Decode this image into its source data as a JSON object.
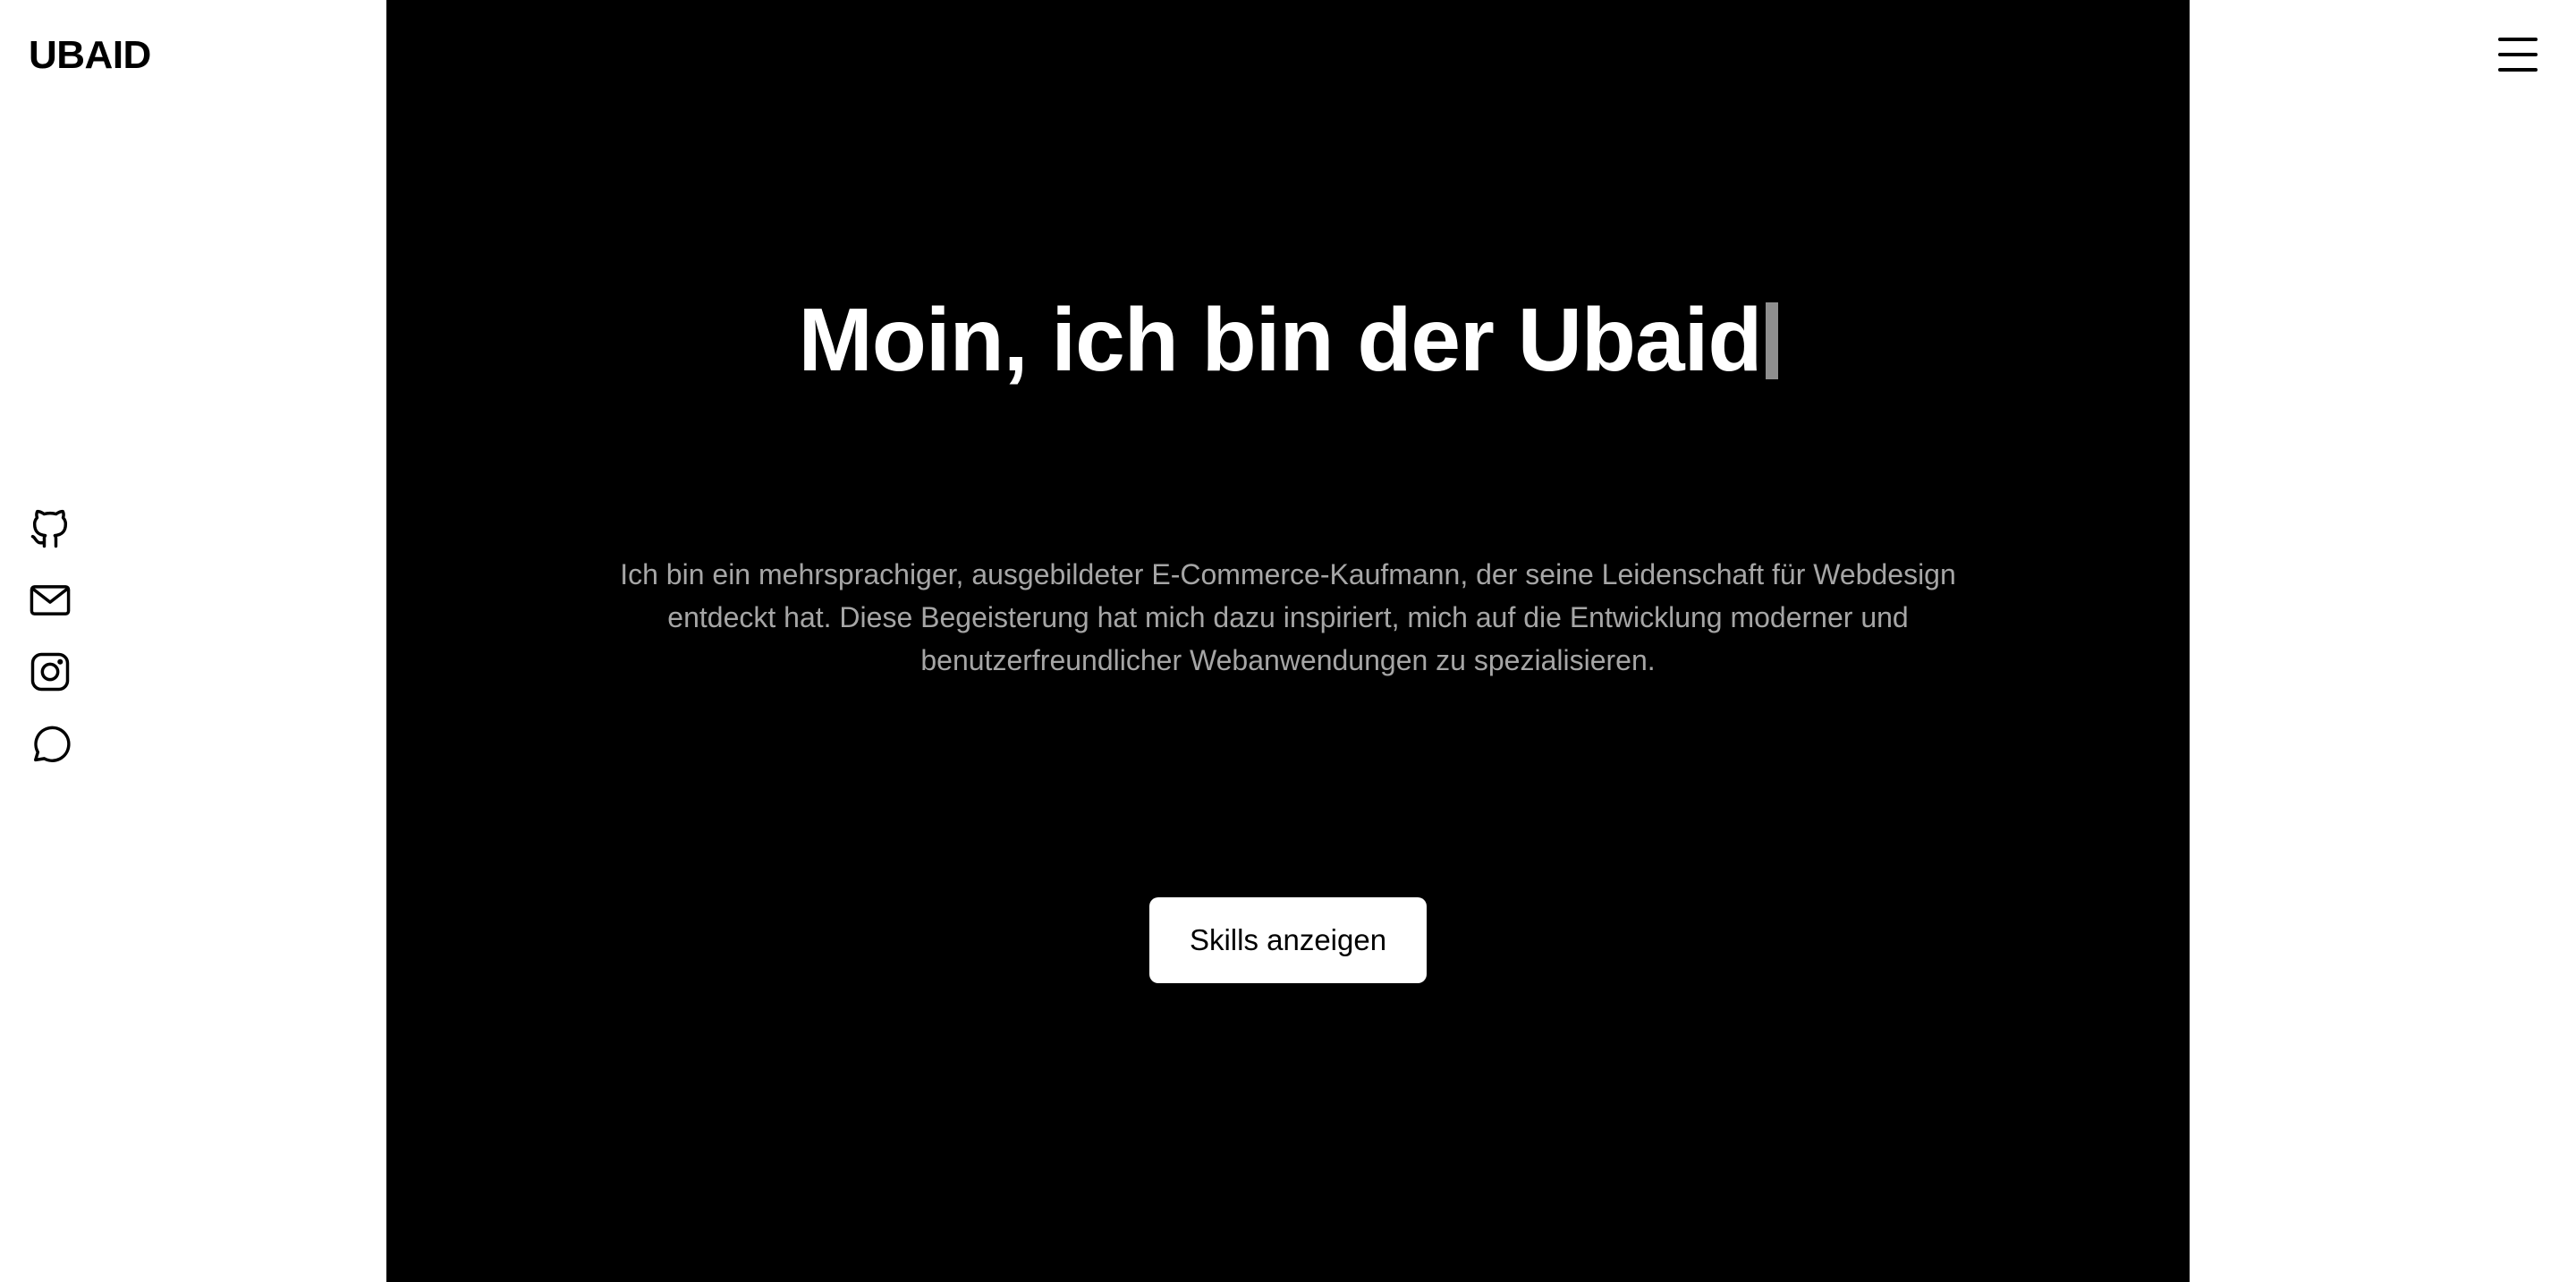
{
  "header": {
    "logo": "UBAID",
    "menu_icon": "hamburger-menu-icon"
  },
  "sidebar": {
    "social_links": [
      {
        "icon": "github-icon"
      },
      {
        "icon": "mail-icon"
      },
      {
        "icon": "instagram-icon"
      },
      {
        "icon": "chat-bubble-icon"
      }
    ]
  },
  "hero": {
    "title": "Moin, ich bin der Ubaid",
    "description": "Ich bin ein mehrsprachiger, ausgebildeter E-Commerce-Kaufmann, der seine Leidenschaft für Webdesign entdeckt hat. Diese Begeisterung hat mich dazu inspiriert, mich auf die Entwicklung moderner und benutzerfreundlicher Webanwendungen zu spezialisieren.",
    "cta_label": "Skills anzeigen"
  },
  "colors": {
    "hero_background": "#000000",
    "page_background": "#ffffff",
    "title_text": "#ffffff",
    "description_text": "#a6a6a6",
    "cursor": "#8f8f8f"
  }
}
